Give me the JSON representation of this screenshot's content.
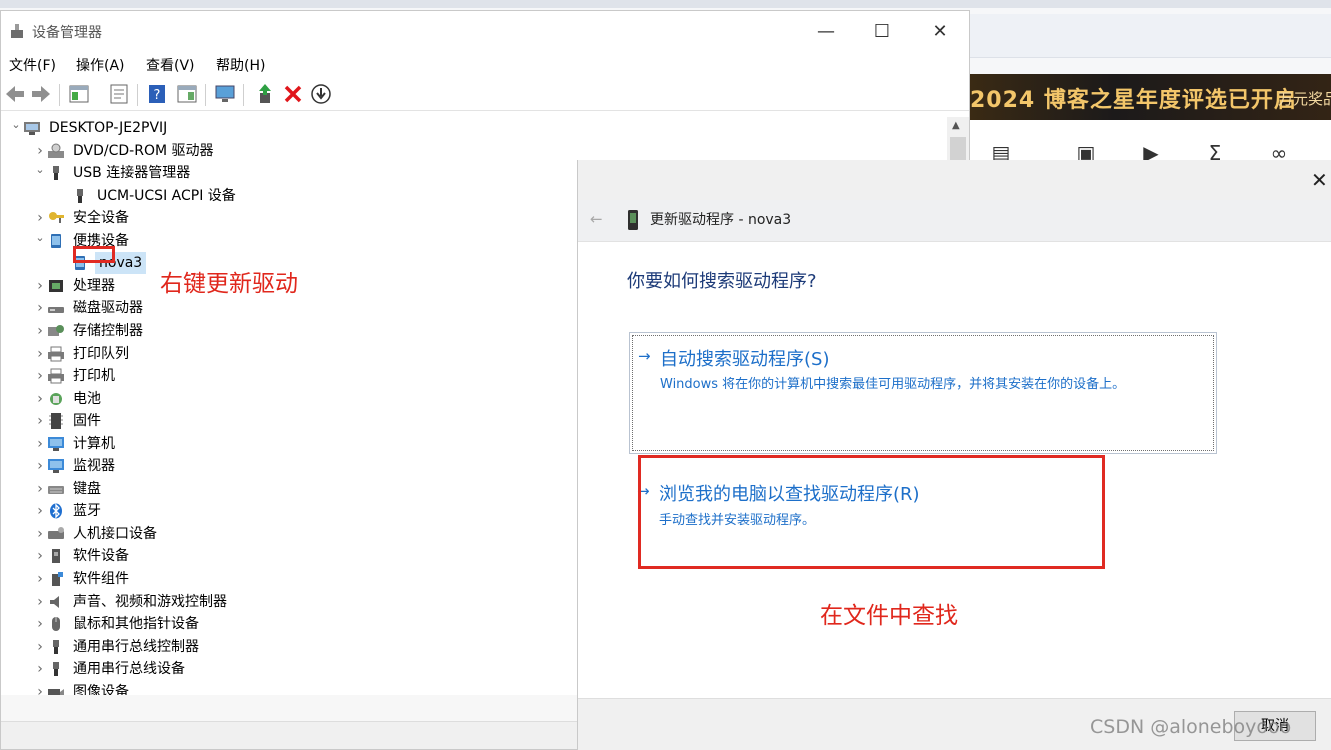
{
  "background_browser": {
    "banner_text": "2024 博客之星年度评选已开启",
    "banner_sub": "万元奖品"
  },
  "device_manager": {
    "title": "设备管理器",
    "window_controls": {
      "minimize": "—",
      "maximize": "☐",
      "close": "✕"
    },
    "menu": [
      "文件(F)",
      "操作(A)",
      "查看(V)",
      "帮助(H)"
    ],
    "tree": [
      {
        "label": "DESKTOP-JE2PVIJ",
        "level": 0,
        "expander": "expanded",
        "icon": "computer-icon"
      },
      {
        "label": "DVD/CD-ROM 驱动器",
        "level": 1,
        "expander": "collapsed",
        "icon": "dvd-drive-icon"
      },
      {
        "label": "USB 连接器管理器",
        "level": 1,
        "expander": "expanded",
        "icon": "usb-connector-icon"
      },
      {
        "label": "UCM-UCSI ACPI 设备",
        "level": 2,
        "expander": "none",
        "icon": "usb-connector-icon"
      },
      {
        "label": "安全设备",
        "level": 1,
        "expander": "collapsed",
        "icon": "security-device-icon"
      },
      {
        "label": "便携设备",
        "level": 1,
        "expander": "expanded",
        "icon": "portable-device-icon"
      },
      {
        "label": "nova3",
        "level": 2,
        "expander": "none",
        "icon": "portable-device-icon",
        "selected": true
      },
      {
        "label": "处理器",
        "level": 1,
        "expander": "collapsed",
        "icon": "processor-icon"
      },
      {
        "label": "磁盘驱动器",
        "level": 1,
        "expander": "collapsed",
        "icon": "disk-drive-icon"
      },
      {
        "label": "存储控制器",
        "level": 1,
        "expander": "collapsed",
        "icon": "storage-controller-icon"
      },
      {
        "label": "打印队列",
        "level": 1,
        "expander": "collapsed",
        "icon": "printer-icon"
      },
      {
        "label": "打印机",
        "level": 1,
        "expander": "collapsed",
        "icon": "printer-icon"
      },
      {
        "label": "电池",
        "level": 1,
        "expander": "collapsed",
        "icon": "battery-icon"
      },
      {
        "label": "固件",
        "level": 1,
        "expander": "collapsed",
        "icon": "firmware-icon"
      },
      {
        "label": "计算机",
        "level": 1,
        "expander": "collapsed",
        "icon": "monitor-icon"
      },
      {
        "label": "监视器",
        "level": 1,
        "expander": "collapsed",
        "icon": "monitor-icon"
      },
      {
        "label": "键盘",
        "level": 1,
        "expander": "collapsed",
        "icon": "keyboard-icon"
      },
      {
        "label": "蓝牙",
        "level": 1,
        "expander": "collapsed",
        "icon": "bluetooth-icon"
      },
      {
        "label": "人机接口设备",
        "level": 1,
        "expander": "collapsed",
        "icon": "hid-icon"
      },
      {
        "label": "软件设备",
        "level": 1,
        "expander": "collapsed",
        "icon": "software-device-icon"
      },
      {
        "label": "软件组件",
        "level": 1,
        "expander": "collapsed",
        "icon": "software-component-icon"
      },
      {
        "label": "声音、视频和游戏控制器",
        "level": 1,
        "expander": "collapsed",
        "icon": "speaker-icon"
      },
      {
        "label": "鼠标和其他指针设备",
        "level": 1,
        "expander": "collapsed",
        "icon": "mouse-icon"
      },
      {
        "label": "通用串行总线控制器",
        "level": 1,
        "expander": "collapsed",
        "icon": "usb-connector-icon"
      },
      {
        "label": "通用串行总线设备",
        "level": 1,
        "expander": "collapsed",
        "icon": "usb-connector-icon"
      },
      {
        "label": "图像设备",
        "level": 1,
        "expander": "collapsed",
        "icon": "camera-icon"
      }
    ]
  },
  "annotations": {
    "right_click_note": "右键更新驱动",
    "find_in_files_note": "在文件中查找",
    "highlight_color": "#e02a22"
  },
  "dialog": {
    "close": "✕",
    "back": "←",
    "header_title": "更新驱动程序 - nova3",
    "question": "你要如何搜索驱动程序?",
    "options": [
      {
        "arrow": "→",
        "title": "自动搜索驱动程序(S)",
        "desc": "Windows 将在你的计算机中搜索最佳可用驱动程序，并将其安装在你的设备上。"
      },
      {
        "arrow": "→",
        "title": "浏览我的电脑以查找驱动程序(R)",
        "desc": "手动查找并安装驱动程序。"
      }
    ],
    "cancel": "取消"
  },
  "watermark": "CSDN @aloneboyooo"
}
